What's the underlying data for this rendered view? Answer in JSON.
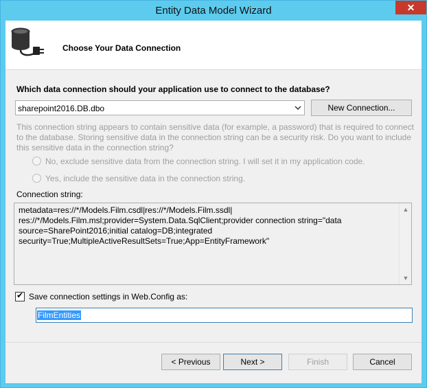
{
  "window": {
    "title": "Entity Data Model Wizard",
    "close_glyph": "✕"
  },
  "header": {
    "title": "Choose Your Data Connection",
    "icon": "database-plug-icon"
  },
  "question": "Which data connection should your application use to connect to the database?",
  "connection_select": {
    "value": "sharepoint2016.DB.dbo",
    "arrow": "chevron-down-icon"
  },
  "new_connection_label": "New Connection...",
  "warning_text": "This connection string appears to contain sensitive data (for example, a password) that is required to connect to the database. Storing sensitive data in the connection string can be a security risk. Do you want to include this sensitive data in the connection string?",
  "radios": [
    {
      "label": "No, exclude sensitive data from the connection string. I will set it in my application code."
    },
    {
      "label": "Yes, include the sensitive data in the connection string."
    }
  ],
  "connection_string_label": "Connection string:",
  "connection_string_lines": [
    "metadata=res://*/Models.Film.csdl|res://*/Models.Film.ssdl|",
    "res://*/Models.Film.msl;provider=System.Data.SqlClient;provider connection string=\"data",
    "source=SharePoint2016;initial catalog=DB;integrated",
    "security=True;MultipleActiveResultSets=True;App=EntityFramework\""
  ],
  "save_checkbox": {
    "label": "Save connection settings in Web.Config as:",
    "checked": true,
    "check_glyph": "✔"
  },
  "entity_name": "FilmEntities",
  "buttons": {
    "previous": "< Previous",
    "next": "Next >",
    "finish": "Finish",
    "cancel": "Cancel"
  },
  "colors": {
    "title_bar": "#5ccbee",
    "close_button": "#c7392b",
    "selection": "#3399ff"
  }
}
